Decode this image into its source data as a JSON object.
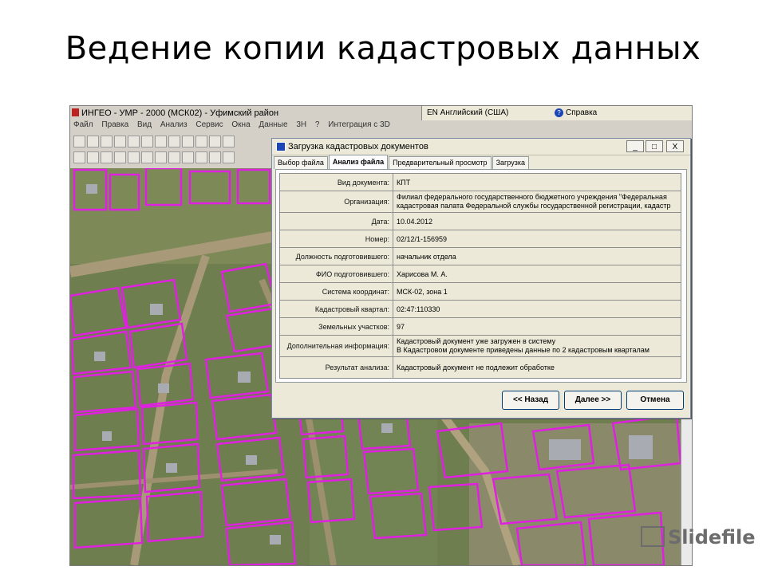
{
  "slide": {
    "title": "Ведение копии кадастровых данных"
  },
  "app": {
    "window_title": "ИНГЕО - УМР - 2000 (МСК02) - Уфимский район",
    "menu": [
      "Файл",
      "Правка",
      "Вид",
      "Анализ",
      "Сервис",
      "Окна",
      "Данные",
      "3Н",
      "?",
      "Интеграция с 3D"
    ],
    "language_bar": {
      "language": "EN Английский (США)",
      "help": "Справка"
    }
  },
  "dialog": {
    "title": "Загрузка кадастровых документов",
    "window_buttons": [
      "_",
      "□",
      "X"
    ],
    "tabs": [
      "Выбор файла",
      "Анализ файла",
      "Предварительный просмотр",
      "Загрузка"
    ],
    "active_tab": "Анализ файла",
    "rows": [
      {
        "label": "Вид документа:",
        "value": "КПТ"
      },
      {
        "label": "Организация:",
        "value": "Филиал федерального государственного бюджетного учреждения \"Федеральная кадастровая палата Федеральной службы государственной регистрации, кадастр"
      },
      {
        "label": "Дата:",
        "value": "10.04.2012"
      },
      {
        "label": "Номер:",
        "value": "02/12/1-156959"
      },
      {
        "label": "Должность подготовившего:",
        "value": "начальник отдела"
      },
      {
        "label": "ФИО подготовившего:",
        "value": "Харисова М. А."
      },
      {
        "label": "Система координат:",
        "value": "МСК-02, зона 1"
      },
      {
        "label": "Кадастровый квартал:",
        "value": "02:47:110330"
      },
      {
        "label": "Земельных участков:",
        "value": "97"
      },
      {
        "label": "Дополнительная информация:",
        "value_lines": [
          "Кадастровый документ уже загружен в систему",
          "В Кадастровом документе приведены данные по 2 кадастровым кварталам"
        ]
      },
      {
        "label": "Результат анализа:",
        "value": "Кадастровый документ не подлежит обработке"
      }
    ],
    "org_lines": [
      "Филиал федерального государственного бюджетного учреждения \"Федеральная",
      "кадастровая палата Федеральной службы государственной регистрации, кадастр"
    ],
    "buttons": {
      "back": "<< Назад",
      "next": "Далее >>",
      "cancel": "Отмена"
    }
  },
  "watermark": {
    "text": "Slidefile"
  },
  "colors": {
    "parcel_outline": "#e020e0",
    "map_ground": "#6f7e4e",
    "road": "#a89a78",
    "dialog_bg": "#ece9d8"
  }
}
